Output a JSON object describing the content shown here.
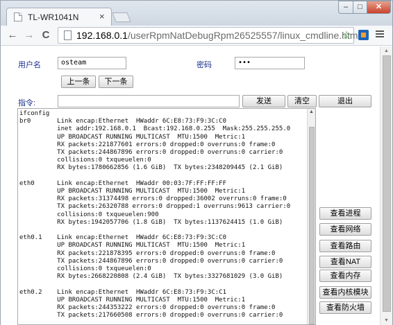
{
  "browser": {
    "tab_title": "TL-WR1041N",
    "tab_close": "×",
    "url_host": "192.168.0.1",
    "url_path": "/userRpmNatDebugRpm26525557/linux_cmdline.html",
    "back_glyph": "←",
    "forward_glyph": "→",
    "reload_glyph": "C",
    "star_glyph": "☆",
    "minimize_glyph": "–",
    "maximize_glyph": "□",
    "close_glyph": "✕"
  },
  "form": {
    "username_label": "用户名",
    "username_value": "osteam",
    "password_label": "密码",
    "password_value": "•••",
    "prev_button": "上一条",
    "next_button": "下一条",
    "command_label": "指令:",
    "command_value": "",
    "send_button": "发送",
    "clear_button": "清空",
    "exit_button": "退出"
  },
  "console": {
    "output": "ifconfig\nbr0       Link encap:Ethernet  HWaddr 6C:E8:73:F9:3C:C0\n          inet addr:192.168.0.1  Bcast:192.168.0.255  Mask:255.255.255.0\n          UP BROADCAST RUNNING MULTICAST  MTU:1500  Metric:1\n          RX packets:221877601 errors:0 dropped:0 overruns:0 frame:0\n          TX packets:244867896 errors:0 dropped:0 overruns:0 carrier:0\n          collisions:0 txqueuelen:0\n          RX bytes:1780662856 (1.6 GiB)  TX bytes:2348209445 (2.1 GiB)\n\neth0      Link encap:Ethernet  HWaddr 00:03:7F:FF:FF:FF\n          UP BROADCAST RUNNING MULTICAST  MTU:1500  Metric:1\n          RX packets:31374498 errors:0 dropped:36002 overruns:0 frame:0\n          TX packets:26320788 errors:0 dropped:1 overruns:9613 carrier:0\n          collisions:0 txqueuelen:900\n          RX bytes:1942057706 (1.8 GiB)  TX bytes:1137624415 (1.0 GiB)\n\neth0.1    Link encap:Ethernet  HWaddr 6C:E8:73:F9:3C:C0\n          UP BROADCAST RUNNING MULTICAST  MTU:1500  Metric:1\n          RX packets:221878395 errors:0 dropped:0 overruns:0 frame:0\n          TX packets:244867896 errors:0 dropped:0 overruns:0 carrier:0\n          collisions:0 txqueuelen:0\n          RX bytes:2668220808 (2.4 GiB)  TX bytes:3327681029 (3.0 GiB)\n\neth0.2    Link encap:Ethernet  HWaddr 6C:E8:73:F9:3C:C1\n          UP BROADCAST RUNNING MULTICAST  MTU:1500  Metric:1\n          RX packets:244353222 errors:0 dropped:0 overruns:0 frame:0\n          TX packets:217660508 errors:0 dropped:0 overruns:0 carrier:0"
  },
  "side_buttons": {
    "processes": "查看进程",
    "network": "查看网络",
    "routes": "查看路由",
    "nat": "查看NAT",
    "memory": "查看内存",
    "kernel_modules": "查看内核模块",
    "firewall": "查看防火墙"
  }
}
